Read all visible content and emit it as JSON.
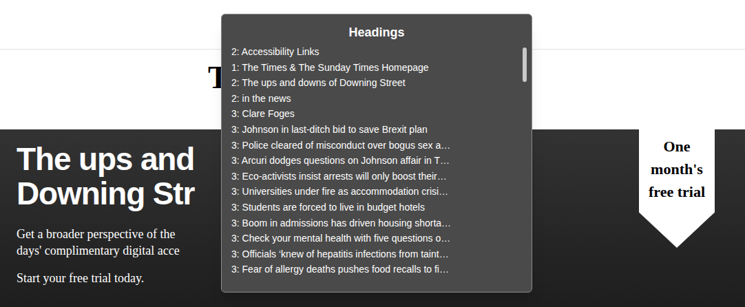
{
  "page": {
    "logo": "T",
    "hero": {
      "title_lines": [
        "The ups and",
        "Downing Str"
      ],
      "paragraph_lines": [
        "Get a broader perspective of the",
        "days' complimentary digital acce"
      ],
      "cta": "Start your free trial today."
    },
    "ribbon": "One month's free trial"
  },
  "headings_panel": {
    "title": "Headings",
    "scroll_level": 0,
    "items": [
      "2: Accessibility Links",
      "1: The Times & The Sunday Times Homepage",
      "2: The ups and downs of Downing Street",
      "2: in the news",
      "3: Clare Foges",
      "3: Johnson in last-ditch bid to save Brexit plan",
      "3: Police cleared of misconduct over bogus sex a…",
      "3: Arcuri dodges questions on Johnson affair in T…",
      "3: Eco-activists insist arrests will only boost their…",
      "3: Universities under fire as accommodation crisi…",
      "3: Students are forced to live in budget hotels",
      "3: Boom in admissions has driven housing shorta…",
      "3: Check your mental health with five questions o…",
      "3: Officials ‘knew of hepatitis infections from taint…",
      "3: Fear of allergy deaths pushes food recalls to fi…"
    ]
  }
}
